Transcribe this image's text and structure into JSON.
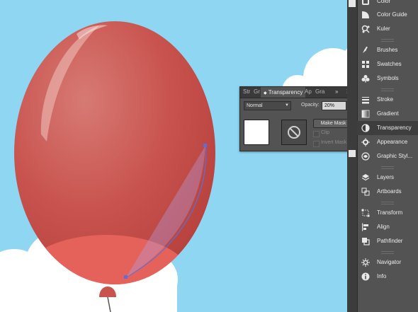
{
  "panel": {
    "tabs": [
      "Str",
      "Gr",
      "Transparency",
      "Ap",
      "Gra"
    ],
    "blend_mode": "Normal",
    "opacity_label": "Opacity:",
    "opacity_value": "20%",
    "make_mask_label": "Make Mask",
    "clip_label": "Clip",
    "invert_mask_label": "Invert Mask"
  },
  "dock": {
    "items": [
      {
        "label": "Color",
        "icon": "color-icon"
      },
      {
        "label": "Color Guide",
        "icon": "color-guide-icon"
      },
      {
        "label": "Kuler",
        "icon": "kuler-icon"
      },
      {
        "label": "Brushes",
        "icon": "brushes-icon"
      },
      {
        "label": "Swatches",
        "icon": "swatches-icon"
      },
      {
        "label": "Symbols",
        "icon": "symbols-icon"
      },
      {
        "label": "Stroke",
        "icon": "stroke-icon"
      },
      {
        "label": "Gradient",
        "icon": "gradient-icon"
      },
      {
        "label": "Transparency",
        "icon": "transparency-icon"
      },
      {
        "label": "Appearance",
        "icon": "appearance-icon"
      },
      {
        "label": "Graphic Styl...",
        "icon": "graphic-styles-icon"
      },
      {
        "label": "Layers",
        "icon": "layers-icon"
      },
      {
        "label": "Artboards",
        "icon": "artboards-icon"
      },
      {
        "label": "Transform",
        "icon": "transform-icon"
      },
      {
        "label": "Align",
        "icon": "align-icon"
      },
      {
        "label": "Pathfinder",
        "icon": "pathfinder-icon"
      },
      {
        "label": "Navigator",
        "icon": "navigator-icon"
      },
      {
        "label": "Info",
        "icon": "info-icon"
      }
    ]
  },
  "colors": {
    "sky": "#8fd6f3",
    "balloon": "#c95551",
    "balloon_highlight": "#e8635a",
    "cloud": "#ffffff",
    "panel_bg": "#535353",
    "selection_path": "#5b6fd6"
  }
}
